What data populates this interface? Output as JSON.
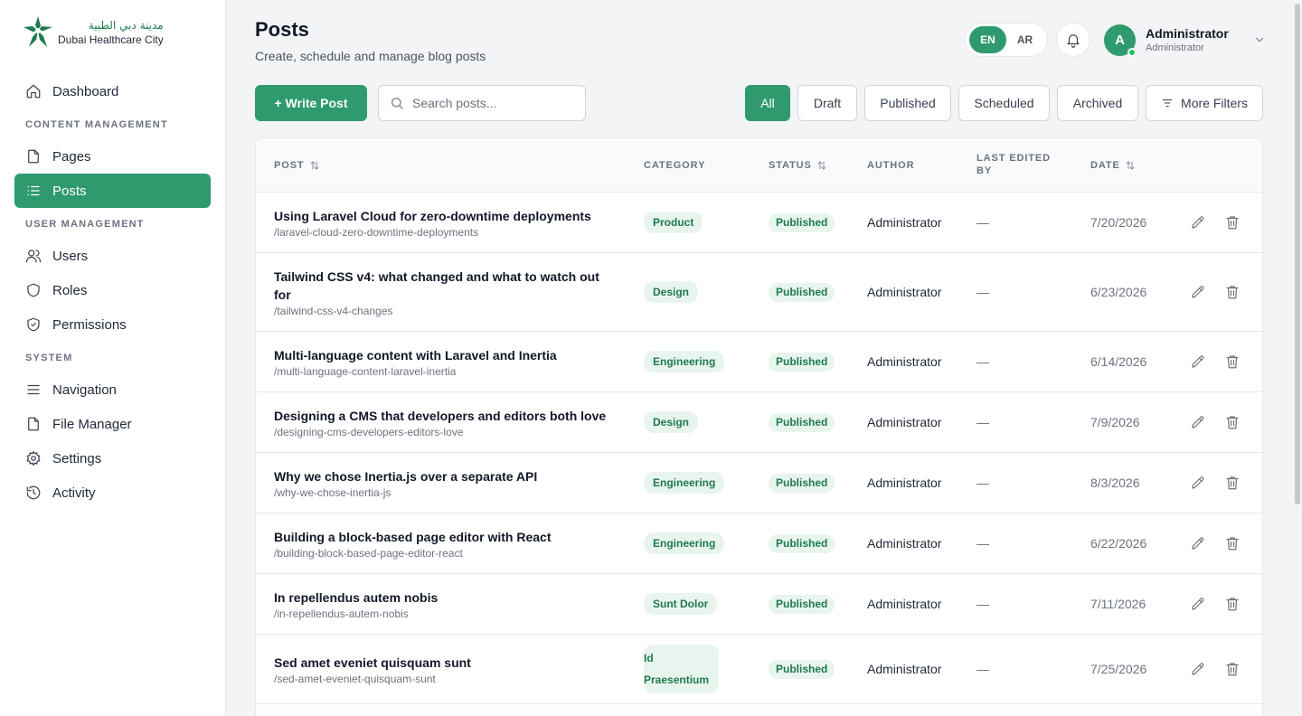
{
  "brand": {
    "name_ar": "مدينة دبي الطبية",
    "name_en": "Dubai Healthcare City",
    "color": "#1f7a4d"
  },
  "sidebar": {
    "dashboard": "Dashboard",
    "section_content": "CONTENT MANAGEMENT",
    "pages": "Pages",
    "posts": "Posts",
    "section_users": "USER MANAGEMENT",
    "users": "Users",
    "roles": "Roles",
    "permissions": "Permissions",
    "section_system": "SYSTEM",
    "navigation": "Navigation",
    "file_manager": "File Manager",
    "settings": "Settings",
    "activity": "Activity"
  },
  "header": {
    "title": "Posts",
    "subtitle": "Create, schedule and manage blog posts",
    "lang_en": "EN",
    "lang_ar": "AR",
    "user_initial": "A",
    "user_name": "Administrator",
    "user_role": "Administrator"
  },
  "toolbar": {
    "write_label": "+ Write Post",
    "search_placeholder": "Search posts...",
    "filters": {
      "all": "All",
      "draft": "Draft",
      "published": "Published",
      "scheduled": "Scheduled",
      "archived": "Archived",
      "more": "More Filters"
    }
  },
  "table": {
    "columns": {
      "post": "POST",
      "category": "CATEGORY",
      "status": "STATUS",
      "author": "AUTHOR",
      "last_edited_1": "LAST EDITED",
      "last_edited_2": "BY",
      "date": "DATE"
    },
    "rows": [
      {
        "title": "Using Laravel Cloud for zero-downtime deployments",
        "slug": "/laravel-cloud-zero-downtime-deployments",
        "category": "Product",
        "status": "Published",
        "author": "Administrator",
        "edited_by": "—",
        "date": "7/20/2026"
      },
      {
        "title": "Tailwind CSS v4: what changed and what to watch out for",
        "slug": "/tailwind-css-v4-changes",
        "category": "Design",
        "status": "Published",
        "author": "Administrator",
        "edited_by": "—",
        "date": "6/23/2026"
      },
      {
        "title": "Multi-language content with Laravel and Inertia",
        "slug": "/multi-language-content-laravel-inertia",
        "category": "Engineering",
        "status": "Published",
        "author": "Administrator",
        "edited_by": "—",
        "date": "6/14/2026"
      },
      {
        "title": "Designing a CMS that developers and editors both love",
        "slug": "/designing-cms-developers-editors-love",
        "category": "Design",
        "status": "Published",
        "author": "Administrator",
        "edited_by": "—",
        "date": "7/9/2026"
      },
      {
        "title": "Why we chose Inertia.js over a separate API",
        "slug": "/why-we-chose-inertia-js",
        "category": "Engineering",
        "status": "Published",
        "author": "Administrator",
        "edited_by": "—",
        "date": "8/3/2026"
      },
      {
        "title": "Building a block-based page editor with React",
        "slug": "/building-block-based-page-editor-react",
        "category": "Engineering",
        "status": "Published",
        "author": "Administrator",
        "edited_by": "—",
        "date": "6/22/2026"
      },
      {
        "title": "In repellendus autem nobis",
        "slug": "/in-repellendus-autem-nobis",
        "category": "Sunt Dolor",
        "status": "Published",
        "author": "Administrator",
        "edited_by": "—",
        "date": "7/11/2026"
      },
      {
        "title": "Sed amet eveniet quisquam sunt",
        "slug": "/sed-amet-eveniet-quisquam-sunt",
        "category": "Id Praesentium",
        "status": "Published",
        "author": "Administrator",
        "edited_by": "—",
        "date": "7/25/2026"
      }
    ]
  },
  "colors": {
    "accent": "#2f9a6e",
    "badge_bg": "#e8f5ee",
    "badge_text": "#1f7a4d",
    "online": "#22c55e"
  },
  "icons": [
    "home-icon",
    "page-icon",
    "list-icon",
    "users-icon",
    "shield-icon",
    "shield-check-icon",
    "menu-icon",
    "file-icon",
    "gear-icon",
    "history-icon",
    "bell-icon",
    "chevron-down-icon",
    "search-icon",
    "filter-icon",
    "sort-icon",
    "edit-icon",
    "trash-icon"
  ]
}
